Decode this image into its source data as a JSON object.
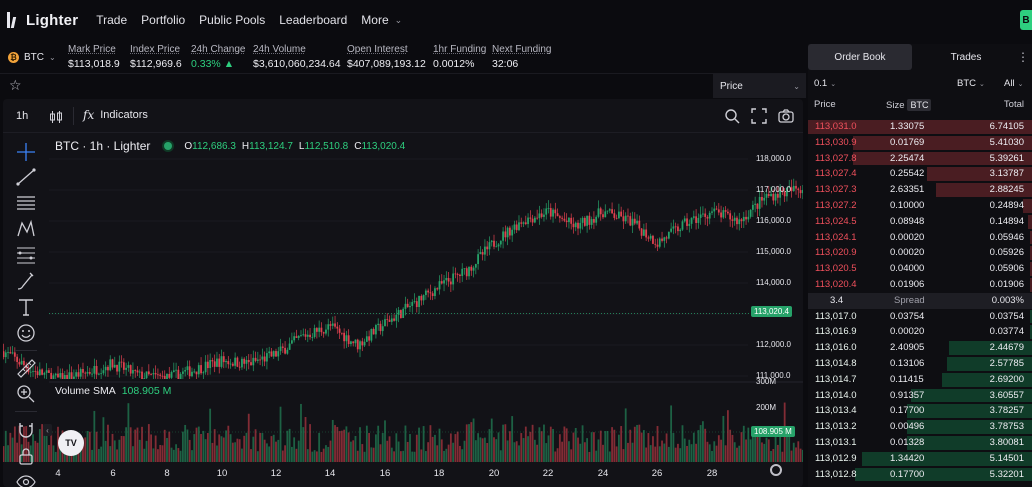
{
  "nav": {
    "logo_text": "Lighter",
    "links": [
      "Trade",
      "Portfolio",
      "Public Pools",
      "Leaderboard"
    ],
    "more_label": "More",
    "right_button_label": "B"
  },
  "market": {
    "symbol": "BTC",
    "coin_glyph": "₿",
    "stats": [
      {
        "label": "Mark Price",
        "value": "$113,018.9"
      },
      {
        "label": "Index Price",
        "value": "$112,969.6"
      },
      {
        "label": "24h Change",
        "value": "0.33% ▲"
      },
      {
        "label": "24h Volume",
        "value": "$3,610,060,234.64"
      },
      {
        "label": "Open Interest",
        "value": "$407,089,193.12"
      },
      {
        "label": "1hr Funding",
        "value": "0.0012%"
      },
      {
        "label": "Next Funding",
        "value": "32:06"
      }
    ],
    "positive_color": "#2ecf7f"
  },
  "subbar": {
    "price_select": "Price"
  },
  "chart": {
    "timeframe": "1h",
    "indicators_label": "Indicators",
    "fx_glyph": "fx",
    "title": "BTC · 1h · Lighter",
    "ohlc": {
      "o_label": "O",
      "o": "112,686.3",
      "h_label": "H",
      "h": "113,124.7",
      "l_label": "L",
      "l": "112,510.8",
      "c_label": "C",
      "c": "113,020.4"
    },
    "volume_label": "Volume SMA",
    "volume_value": "108.905 M",
    "last_price_tag": "113,020.4",
    "volume_tag": "108.905 M",
    "tv_logo": "TV",
    "price_axis": [
      "118,000.0",
      "117,000.0",
      "116,000.0",
      "115,000.0",
      "114,000.0",
      "113,000.0",
      "112,000.0",
      "111,000.0"
    ],
    "volume_axis": [
      "300M",
      "200M"
    ],
    "x_axis": [
      "4",
      "6",
      "8",
      "10",
      "12",
      "14",
      "16",
      "18",
      "20",
      "22",
      "24",
      "26",
      "28"
    ],
    "up_color": "#26a269",
    "down_color": "#e0414f"
  },
  "chart_data": {
    "type": "candlestick",
    "title": "BTC · 1h · Lighter",
    "xlabel": "",
    "ylabel": "",
    "x_range": [
      "3",
      "29"
    ],
    "ylim": [
      110900,
      118300
    ],
    "daily_path_close": [
      {
        "x": "3.0",
        "y": 111800
      },
      {
        "x": "3.5",
        "y": 111200
      },
      {
        "x": "4.0",
        "y": 110900
      },
      {
        "x": "4.5",
        "y": 111100
      },
      {
        "x": "5.0",
        "y": 111400
      },
      {
        "x": "5.5",
        "y": 111000
      },
      {
        "x": "6.0",
        "y": 110950
      },
      {
        "x": "6.5",
        "y": 111200
      },
      {
        "x": "7.0",
        "y": 111500
      },
      {
        "x": "7.5",
        "y": 111400
      },
      {
        "x": "8.0",
        "y": 111700
      },
      {
        "x": "8.5",
        "y": 112300
      },
      {
        "x": "9.0",
        "y": 112600
      },
      {
        "x": "9.5",
        "y": 112000
      },
      {
        "x": "10.0",
        "y": 112700
      },
      {
        "x": "10.5",
        "y": 113300
      },
      {
        "x": "11.0",
        "y": 113900
      },
      {
        "x": "11.5",
        "y": 114400
      },
      {
        "x": "12.0",
        "y": 115300
      },
      {
        "x": "12.5",
        "y": 116000
      },
      {
        "x": "13.0",
        "y": 116300
      },
      {
        "x": "13.5",
        "y": 115800
      },
      {
        "x": "14.0",
        "y": 116300
      },
      {
        "x": "14.5",
        "y": 116000
      },
      {
        "x": "15.0",
        "y": 115300
      },
      {
        "x": "15.5",
        "y": 115900
      },
      {
        "x": "16.0",
        "y": 116300
      },
      {
        "x": "16.5",
        "y": 116000
      },
      {
        "x": "17.0",
        "y": 116800
      },
      {
        "x": "17.5",
        "y": 117000
      },
      {
        "x": "18.0",
        "y": 117200
      },
      {
        "x": "18.5",
        "y": 117800
      },
      {
        "x": "19.0",
        "y": 117600
      },
      {
        "x": "19.5",
        "y": 116900
      },
      {
        "x": "20.0",
        "y": 115700
      },
      {
        "x": "20.5",
        "y": 115800
      },
      {
        "x": "21.0",
        "y": 115900
      },
      {
        "x": "21.5",
        "y": 115700
      },
      {
        "x": "22.0",
        "y": 115600
      },
      {
        "x": "22.2",
        "y": 114000
      },
      {
        "x": "22.5",
        "y": 112400
      },
      {
        "x": "23.0",
        "y": 112700
      },
      {
        "x": "23.5",
        "y": 113020
      }
    ],
    "last_close": 113020.4,
    "volume_sma": 108.905
  },
  "orderbook": {
    "tabs": [
      "Order Book",
      "Trades"
    ],
    "tick": "0.1",
    "unit": "BTC",
    "filter": "All",
    "headers": {
      "price": "Price",
      "size": "Size",
      "size_badge": "BTC",
      "total": "Total"
    },
    "asks": [
      {
        "price": "113,031.0",
        "size": "1.33075",
        "total": "6.74105",
        "depth": 1.0
      },
      {
        "price": "113,030.9",
        "size": "0.01769",
        "total": "5.41030",
        "depth": 0.8
      },
      {
        "price": "113,027.8",
        "size": "2.25474",
        "total": "5.39261",
        "depth": 0.8
      },
      {
        "price": "113,027.4",
        "size": "0.25542",
        "total": "3.13787",
        "depth": 0.47
      },
      {
        "price": "113,027.3",
        "size": "2.63351",
        "total": "2.88245",
        "depth": 0.43
      },
      {
        "price": "113,027.2",
        "size": "0.10000",
        "total": "0.24894",
        "depth": 0.04
      },
      {
        "price": "113,024.5",
        "size": "0.08948",
        "total": "0.14894",
        "depth": 0.02
      },
      {
        "price": "113,024.1",
        "size": "0.00020",
        "total": "0.05946",
        "depth": 0.01
      },
      {
        "price": "113,020.9",
        "size": "0.00020",
        "total": "0.05926",
        "depth": 0.01
      },
      {
        "price": "113,020.5",
        "size": "0.04000",
        "total": "0.05906",
        "depth": 0.01
      },
      {
        "price": "113,020.4",
        "size": "0.01906",
        "total": "0.01906",
        "depth": 0.005
      }
    ],
    "spread": {
      "value": "3.4",
      "label": "Spread",
      "percent": "0.003%"
    },
    "bids": [
      {
        "price": "113,017.0",
        "size": "0.03754",
        "total": "0.03754",
        "depth": 0.01
      },
      {
        "price": "113,016.9",
        "size": "0.00020",
        "total": "0.03774",
        "depth": 0.01
      },
      {
        "price": "113,016.0",
        "size": "2.40905",
        "total": "2.44679",
        "depth": 0.37
      },
      {
        "price": "113,014.8",
        "size": "0.13106",
        "total": "2.57785",
        "depth": 0.38
      },
      {
        "price": "113,014.7",
        "size": "0.11415",
        "total": "2.69200",
        "depth": 0.4
      },
      {
        "price": "113,014.0",
        "size": "0.91357",
        "total": "3.60557",
        "depth": 0.54
      },
      {
        "price": "113,013.4",
        "size": "0.17700",
        "total": "3.78257",
        "depth": 0.56
      },
      {
        "price": "113,013.2",
        "size": "0.00496",
        "total": "3.78753",
        "depth": 0.56
      },
      {
        "price": "113,013.1",
        "size": "0.01328",
        "total": "3.80081",
        "depth": 0.56
      },
      {
        "price": "113,012.9",
        "size": "1.34420",
        "total": "5.14501",
        "depth": 0.76
      },
      {
        "price": "113,012.8",
        "size": "0.17700",
        "total": "5.32201",
        "depth": 0.79
      }
    ]
  }
}
